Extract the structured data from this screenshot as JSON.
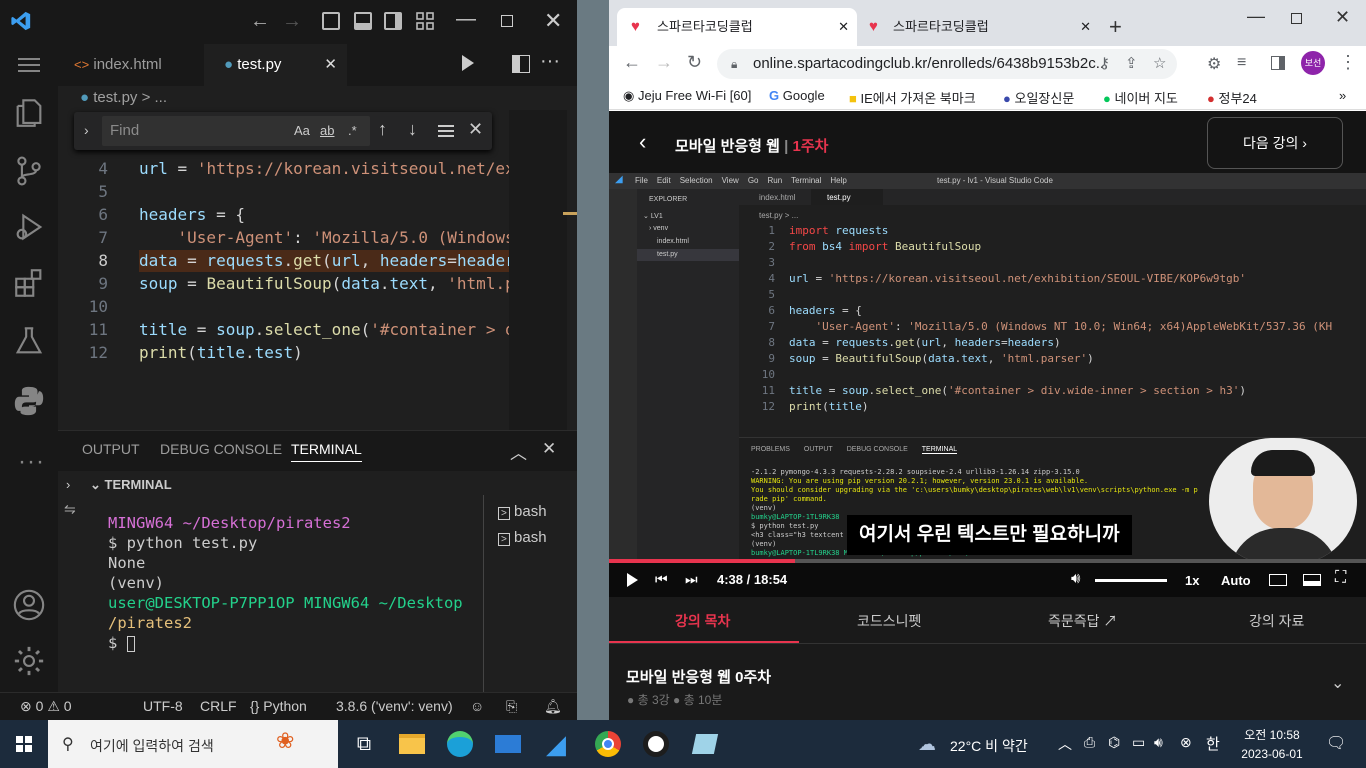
{
  "vscode": {
    "tabs": [
      {
        "label": "index.html",
        "icon": "html-icon"
      },
      {
        "label": "test.py",
        "icon": "python-icon"
      }
    ],
    "breadcrumb": "test.py > ...",
    "find": {
      "placeholder": "Find",
      "opt_case": "Aa",
      "opt_word": "ab",
      "opt_regex": ".*"
    },
    "code_lines": [
      {
        "n": "4",
        "html": "<span class='var'>url</span> = <span class='str'>'https://korean.visitseoul.net/exh</span>"
      },
      {
        "n": "5",
        "html": ""
      },
      {
        "n": "6",
        "html": "<span class='var'>headers</span> = {"
      },
      {
        "n": "7",
        "html": "    <span class='str'>'User-Agent'</span>: <span class='str'>'Mozilla/5.0 (Windows</span>"
      },
      {
        "n": "8",
        "html": "<span class='var'>data</span> = <span class='var'>requests</span>.<span class='fn'>get</span>(<span class='var'>url</span>, <span class='var'>headers</span>=<span class='var'>headers</span>"
      },
      {
        "n": "9",
        "html": "<span class='var'>soup</span> = <span class='fn'>BeautifulSoup</span>(<span class='var'>data</span>.<span class='var'>text</span>, <span class='str'>'html.pa</span>"
      },
      {
        "n": "10",
        "html": ""
      },
      {
        "n": "11",
        "html": "<span class='var'>title</span> = <span class='var'>soup</span>.<span class='fn'>select_one</span>(<span class='str'>'#container &gt; di</span>"
      },
      {
        "n": "12",
        "html": "<span class='fn'>print</span>(<span class='var'>title</span>.<span class='var'>test</span>)"
      }
    ],
    "panel_tabs": [
      "OUTPUT",
      "DEBUG CONSOLE",
      "TERMINAL"
    ],
    "terminal_header": "TERMINAL",
    "terminal_lines": [
      {
        "t": "MINGW64 ~/Desktop/pirates2",
        "c": "#d670d6"
      },
      {
        "t": "$ python test.py",
        "c": "#cccccc"
      },
      {
        "t": "None",
        "c": "#cccccc"
      },
      {
        "t": "(venv)",
        "c": "#cccccc"
      },
      {
        "t": "user@DESKTOP-P7PP1OP MINGW64 ~/Desktop",
        "c": "#23d18b"
      },
      {
        "t": "/pirates2",
        "c": "#e5c07b"
      },
      {
        "t": "$ ",
        "c": "#cccccc"
      }
    ],
    "shells": [
      "bash",
      "bash"
    ],
    "status": {
      "errors": "0",
      "warnings": "0",
      "encoding": "UTF-8",
      "eol": "CRLF",
      "lang": "Python",
      "interpreter": "3.8.6 ('venv': venv)"
    }
  },
  "chrome": {
    "tabs": [
      "스파르타코딩클럽",
      "스파르타코딩클럽"
    ],
    "url": "online.spartacodingclub.kr/enrolleds/6438b9153b2c...",
    "profile": "보선",
    "bookmarks": [
      "Jeju Free Wi-Fi [60]",
      "Google",
      "IE에서 가져온 북마크",
      "오일장신문",
      "네이버 지도",
      "정부24"
    ],
    "course_title": "모바일 반응형 웹",
    "week": "1주차",
    "next_label": "다음 강의",
    "video": {
      "subtitle": "여기서 우린 텍스트만 필요하니까",
      "current": "4:38",
      "sep": "/",
      "total": "18:54",
      "speed": "1x",
      "quality": "Auto",
      "progress": 0.246
    },
    "menu_tabs": [
      "강의 목차",
      "코드스니펫",
      "즉문즉답",
      "강의 자료"
    ],
    "section_title": "모바일 반응형 웹 0주차",
    "section_meta": [
      "총 3강",
      "총 10분"
    ]
  },
  "inner_vscode": {
    "title": "test.py - lv1 - Visual Studio Code",
    "menus": [
      "File",
      "Edit",
      "Selection",
      "View",
      "Go",
      "Run",
      "Terminal",
      "Help"
    ],
    "explorer": "EXPLORER",
    "tree": [
      "LV1",
      "venv",
      "index.html",
      "test.py"
    ],
    "tabs": [
      "index.html",
      "test.py"
    ],
    "crumb": "test.py > ...",
    "lines": [
      {
        "n": "1",
        "html": "<span class='kw'>import</span> <span class='var'>requests</span>"
      },
      {
        "n": "2",
        "html": "<span class='kw'>from</span> <span class='var'>bs4</span> <span class='kw'>import</span> <span class='fn'>BeautifulSoup</span>"
      },
      {
        "n": "3",
        "html": ""
      },
      {
        "n": "4",
        "html": "<span class='var'>url</span> = <span class='str'>'https://korean.visitseoul.net/exhibition/SEOUL-VIBE/KOP6w9tgb'</span>"
      },
      {
        "n": "5",
        "html": ""
      },
      {
        "n": "6",
        "html": "<span class='var'>headers</span> = {"
      },
      {
        "n": "7",
        "html": "    <span class='str'>'User-Agent'</span>: <span class='str'>'Mozilla/5.0 (Windows NT 10.0; Win64; x64)AppleWebKit/537.36 (KH</span>"
      },
      {
        "n": "8",
        "html": "<span class='var'>data</span> = <span class='var'>requests</span>.<span class='fn'>get</span>(<span class='var'>url</span>, <span class='var'>headers</span>=<span class='var'>headers</span>)"
      },
      {
        "n": "9",
        "html": "<span class='var'>soup</span> = <span class='fn'>BeautifulSoup</span>(<span class='var'>data</span>.<span class='var'>text</span>, <span class='str'>'html.parser'</span>)"
      },
      {
        "n": "10",
        "html": ""
      },
      {
        "n": "11",
        "html": "<span class='var'>title</span> = <span class='var'>soup</span>.<span class='fn'>select_one</span>(<span class='str'>'#container &gt; div.wide-inner &gt; section &gt; h3'</span>)"
      },
      {
        "n": "12",
        "html": "<span class='fn'>print</span>(<span class='var'>title</span>)"
      }
    ],
    "panel_tabs": [
      "PROBLEMS",
      "OUTPUT",
      "DEBUG CONSOLE",
      "TERMINAL"
    ],
    "term": [
      {
        "t": "-2.1.2 pymongo-4.3.3 requests-2.28.2 soupsieve-2.4 urllib3-1.26.14 zipp-3.15.0",
        "c": "#ccc"
      },
      {
        "t": "WARNING: You are using pip version 20.2.1; however, version 23.0.1 is available.",
        "c": "#e5e510"
      },
      {
        "t": "You should consider upgrading via the 'c:\\users\\bumky\\desktop\\pirates\\web\\lv1\\venv\\scripts\\python.exe -m p",
        "c": "#e5e510"
      },
      {
        "t": "rade pip' command.",
        "c": "#e5e510"
      },
      {
        "t": "(venv)",
        "c": "#ccc"
      },
      {
        "t": "bumky@LAPTOP-1TL9RK38",
        "c": "#23d18b"
      },
      {
        "t": "$ python test.py",
        "c": "#ccc"
      },
      {
        "t": "<h3 class=\"h3 textcent",
        "c": "#ccc"
      },
      {
        "t": "(venv)",
        "c": "#ccc"
      },
      {
        "t": "bumky@LAPTOP-1TL9RK38 MINGW64 ~/Desktop/pirates/web/lv1",
        "c": "#23d18b"
      }
    ]
  },
  "taskbar": {
    "search_placeholder": "여기에 입력하여 검색",
    "weather": "22°C  비 약간",
    "ime": "한",
    "time_top": "오전 10:58",
    "date": "2023-06-01"
  }
}
